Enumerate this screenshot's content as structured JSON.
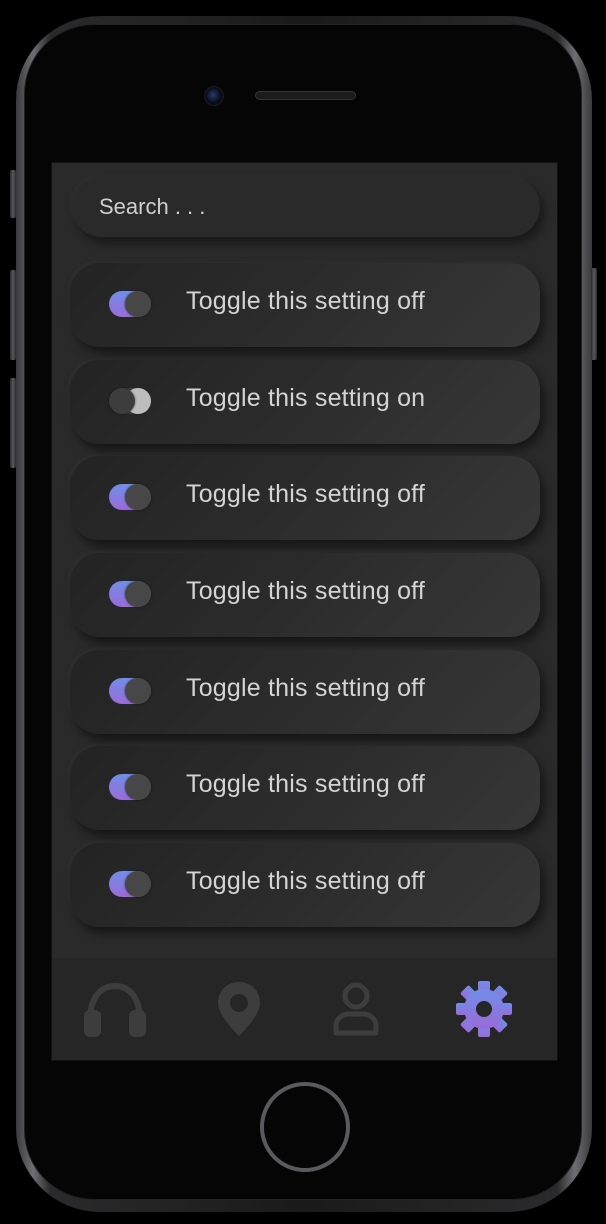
{
  "search": {
    "placeholder": "Search . . ."
  },
  "settings": [
    {
      "label": "Toggle this setting off",
      "state": "on"
    },
    {
      "label": "Toggle this setting on",
      "state": "off"
    },
    {
      "label": "Toggle this setting off",
      "state": "on"
    },
    {
      "label": "Toggle this setting off",
      "state": "on"
    },
    {
      "label": "Toggle this setting off",
      "state": "on"
    },
    {
      "label": "Toggle this setting off",
      "state": "on"
    },
    {
      "label": "Toggle this setting off",
      "state": "on"
    }
  ],
  "bottom_nav": {
    "items": [
      {
        "icon": "headphones-icon",
        "active": false
      },
      {
        "icon": "location-pin-icon",
        "active": false
      },
      {
        "icon": "user-icon",
        "active": false
      },
      {
        "icon": "gear-icon",
        "active": true
      }
    ]
  },
  "colors": {
    "accent_start": "#6f8fe8",
    "accent_end": "#9b6ad8",
    "inactive_icon": "#3d3d3d",
    "screen_background": "#2a2a2a",
    "text": "#d4d4d4"
  }
}
